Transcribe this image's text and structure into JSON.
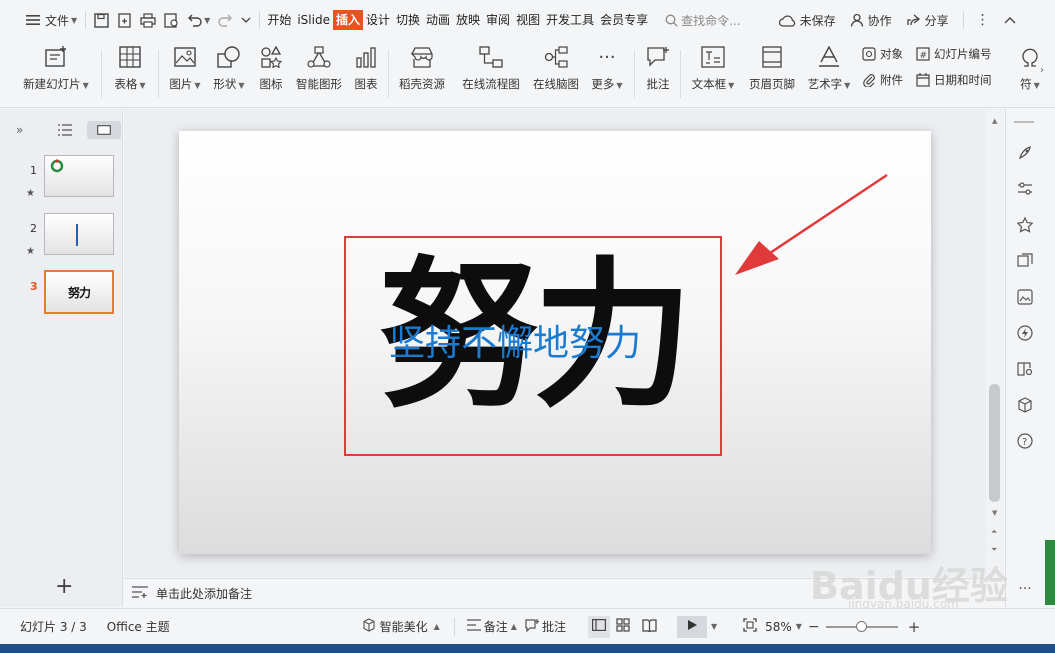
{
  "topbar": {
    "file_menu": "文件",
    "tabs": [
      "开始",
      "iSlide",
      "插入",
      "设计",
      "切换",
      "动画",
      "放映",
      "审阅",
      "视图",
      "开发工具",
      "会员专享"
    ],
    "active_tab": "插入",
    "search_placeholder": "查找命令...",
    "unsaved": "未保存",
    "collab": "协作",
    "share": "分享"
  },
  "ribbon": {
    "new_slide": "新建幻灯片",
    "table": "表格",
    "picture": "图片",
    "shape": "形状",
    "icon": "图标",
    "smart_graphic": "智能图形",
    "chart": "图表",
    "docer_resource": "稻壳资源",
    "online_flowchart": "在线流程图",
    "online_mindmap": "在线脑图",
    "more": "更多",
    "comment": "批注",
    "textbox": "文本框",
    "header_footer": "页眉页脚",
    "wordart": "艺术字",
    "object": "对象",
    "slide_number": "幻灯片编号",
    "attachment": "附件",
    "date_time": "日期和时间",
    "symbol": "符"
  },
  "slides_panel": {
    "slides": [
      {
        "number": "1",
        "thumb_text": ""
      },
      {
        "number": "2",
        "thumb_text": ""
      },
      {
        "number": "3",
        "thumb_text": "努力"
      }
    ],
    "add_icon": "plus-icon"
  },
  "slide": {
    "big_word": "努力",
    "subtitle": "坚持不懈地努力"
  },
  "notes": {
    "placeholder": "单击此处添加备注"
  },
  "status": {
    "slide_count": "幻灯片 3 / 3",
    "theme": "Office 主题",
    "smart_beautify": "智能美化",
    "notes_btn": "备注",
    "comment_btn": "批注",
    "zoom": "58%"
  },
  "watermark": {
    "brand": "Baidu经验",
    "url": "jingyan.baidu.com"
  },
  "colors": {
    "accent": "#e8541f",
    "highlight_box": "#e03a3a",
    "subtitle_blue": "#1b7bd1",
    "taskbar": "#1e4f8a"
  }
}
